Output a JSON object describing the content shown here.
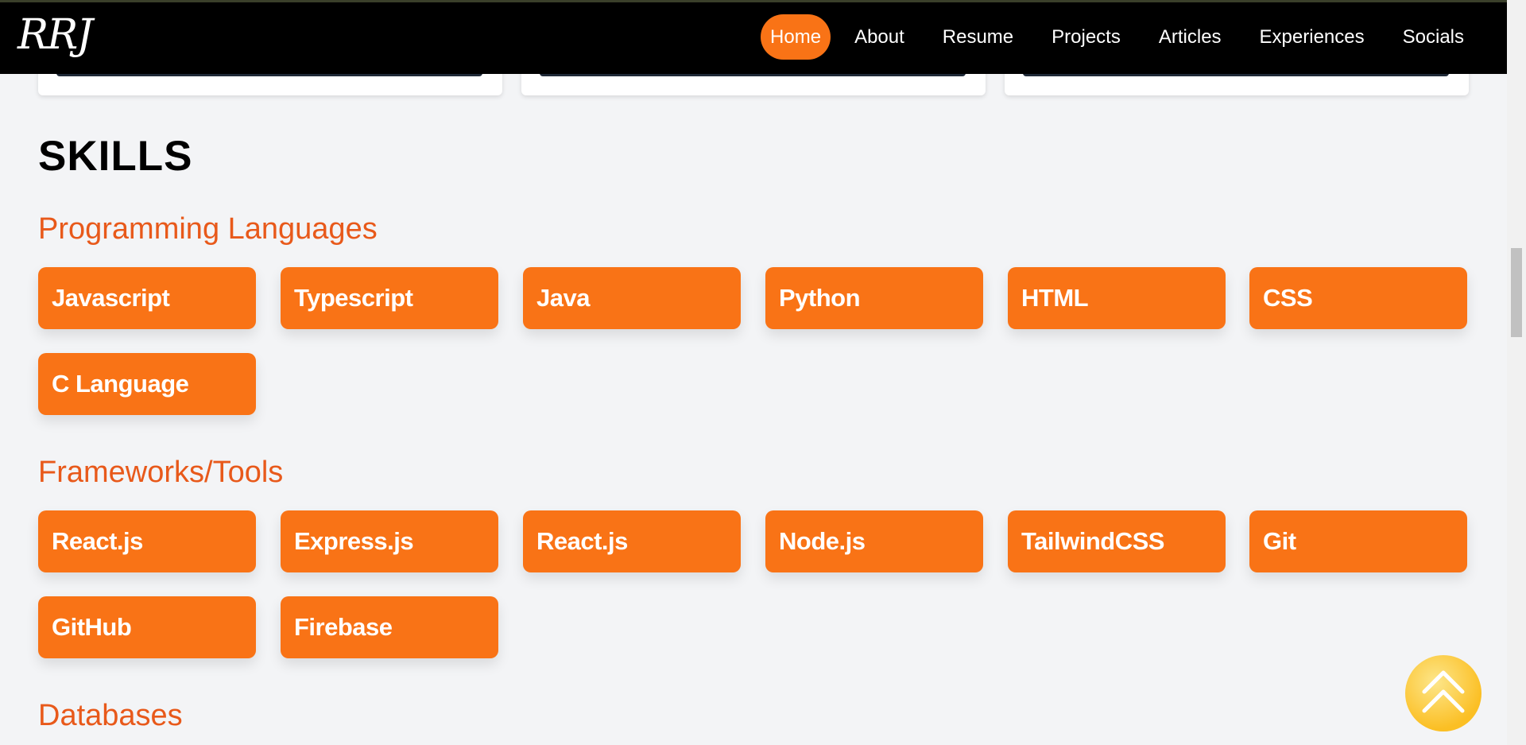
{
  "nav": {
    "logo": "RRJ",
    "links": [
      "Home",
      "About",
      "Resume",
      "Projects",
      "Articles",
      "Experiences",
      "Socials"
    ],
    "active": "Home"
  },
  "skills": {
    "title": "SKILLS",
    "sections": [
      {
        "heading": "Programming Languages",
        "items": [
          "Javascript",
          "Typescript",
          "Java",
          "Python",
          "HTML",
          "CSS",
          "C Language"
        ]
      },
      {
        "heading": "Frameworks/Tools",
        "items": [
          "React.js",
          "Express.js",
          "React.js",
          "Node.js",
          "TailwindCSS",
          "Git",
          "GitHub",
          "Firebase"
        ]
      },
      {
        "heading": "Databases",
        "items": []
      }
    ]
  },
  "icons": {
    "scroll_top": "double-chevron-up-icon"
  },
  "colors": {
    "accent": "#f97316",
    "heading": "#e8591a",
    "navbar": "#000000",
    "background": "#f3f4f6",
    "scroll_top": "#fbbf24"
  }
}
